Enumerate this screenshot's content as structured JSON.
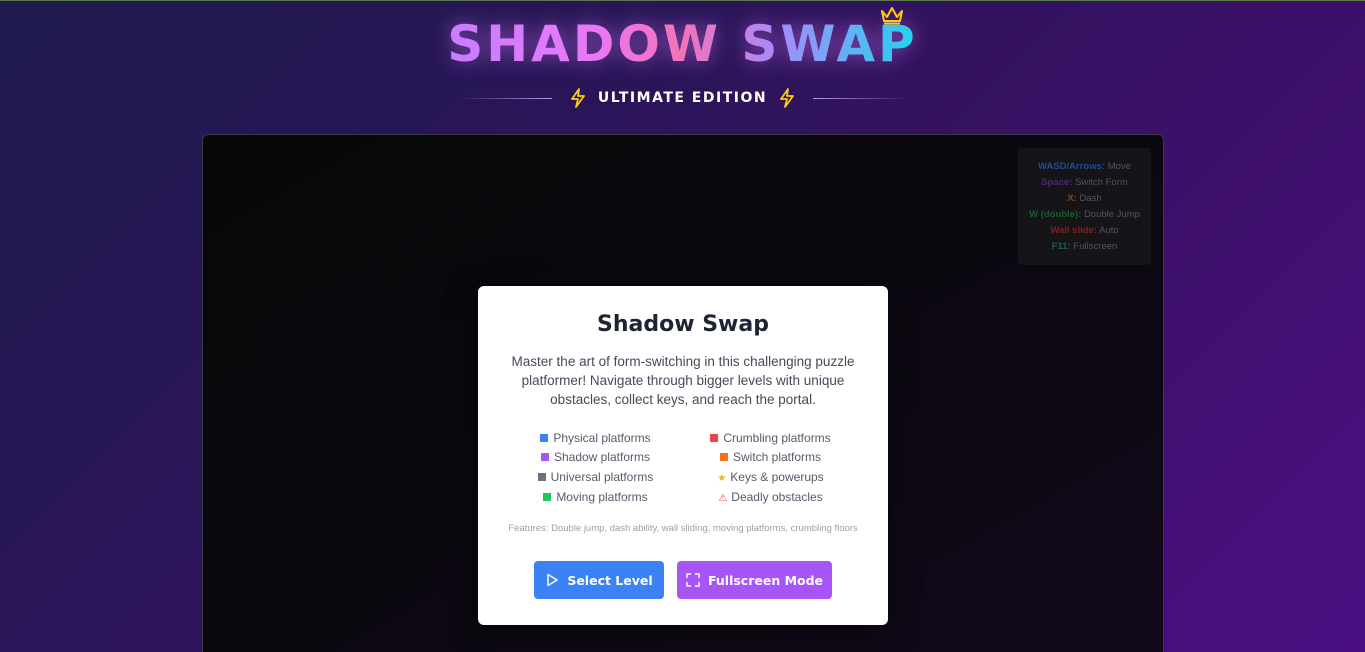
{
  "header": {
    "title": "SHADOW SWAP",
    "edition": "ULTIMATE EDITION",
    "icons": [
      "crown-icon",
      "lightning-icon"
    ]
  },
  "controls": [
    {
      "key": "WASD/Arrows:",
      "value": "Move",
      "key_color": "#1f4e8c"
    },
    {
      "key": "Space:",
      "value": "Switch Form",
      "key_color": "#4a2a6e"
    },
    {
      "key": "X:",
      "value": "Dash",
      "key_color": "#7a4a1a"
    },
    {
      "key": "W (double):",
      "value": "Double Jump",
      "key_color": "#1f5a30"
    },
    {
      "key": "Wall slide:",
      "value": "Auto",
      "key_color": "#7a2222"
    },
    {
      "key": "F11:",
      "value": "Fullscreen",
      "key_color": "#1a5a5a"
    }
  ],
  "modal": {
    "title": "Shadow Swap",
    "description": "Master the art of form-switching in this challenging puzzle platformer! Navigate through bigger levels with unique obstacles, collect keys, and reach the portal.",
    "legend": [
      {
        "label": "Physical platforms",
        "marker": "square",
        "color": "#3b82f6"
      },
      {
        "label": "Crumbling platforms",
        "marker": "square",
        "color": "#ef4444"
      },
      {
        "label": "Shadow platforms",
        "marker": "square",
        "color": "#a855f7"
      },
      {
        "label": "Switch platforms",
        "marker": "square",
        "color": "#f97316"
      },
      {
        "label": "Universal platforms",
        "marker": "square",
        "color": "#6b7280"
      },
      {
        "label": "Keys & powerups",
        "marker": "★",
        "color": "#eab308"
      },
      {
        "label": "Moving platforms",
        "marker": "square",
        "color": "#22c55e"
      },
      {
        "label": "Deadly obstacles",
        "marker": "⚠",
        "color": "#ef4444"
      }
    ],
    "features": "Features: Double jump, dash ability, wall sliding, moving platforms, crumbling floors",
    "buttons": {
      "select_level": "Select Level",
      "fullscreen": "Fullscreen Mode"
    }
  },
  "colors": {
    "select_button": "#3b82f6",
    "fullscreen_button": "#a855f7",
    "title_accent": "#e879f9",
    "crown": "#facc15"
  }
}
